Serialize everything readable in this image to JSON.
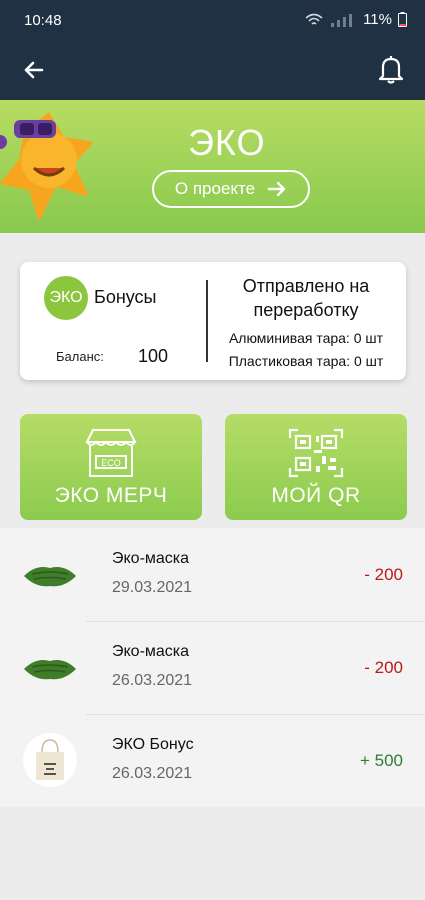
{
  "status_bar": {
    "time": "10:48",
    "battery": "11%"
  },
  "header": {
    "back_icon": "arrow-left-icon",
    "bell_icon": "bell-icon"
  },
  "hero": {
    "logo_text": "ЭКО",
    "about_label": "О проекте"
  },
  "bonus_card": {
    "icon_text": "ЭКО",
    "title": "Бонусы",
    "balance_label": "Баланс:",
    "balance_value": "100",
    "sent_title": "Отправлено на переработку",
    "aluminum_label": "Алюминивая тара:",
    "aluminum_value": "0 шт",
    "plastic_label": "Пластиковая тара:",
    "plastic_value": "0 шт"
  },
  "actions": [
    {
      "label": "ЭКО МЕРЧ",
      "icon": "shop-icon"
    },
    {
      "label": "МОЙ QR",
      "icon": "qr-code-icon"
    }
  ],
  "transactions": [
    {
      "name": "Эко-маска",
      "date": "29.03.2021",
      "amount": "- 200",
      "type": "negative",
      "thumb": "mask-icon"
    },
    {
      "name": "Эко-маска",
      "date": "26.03.2021",
      "amount": "- 200",
      "type": "negative",
      "thumb": "mask-icon"
    },
    {
      "name": "ЭКО Бонус",
      "date": "26.03.2021",
      "amount": "+ 500",
      "type": "positive",
      "thumb": "tote-bag-icon"
    }
  ],
  "colors": {
    "header": "#1f3143",
    "green": "#8cc63e",
    "negative": "#b71c1c",
    "positive": "#2e7d32"
  }
}
